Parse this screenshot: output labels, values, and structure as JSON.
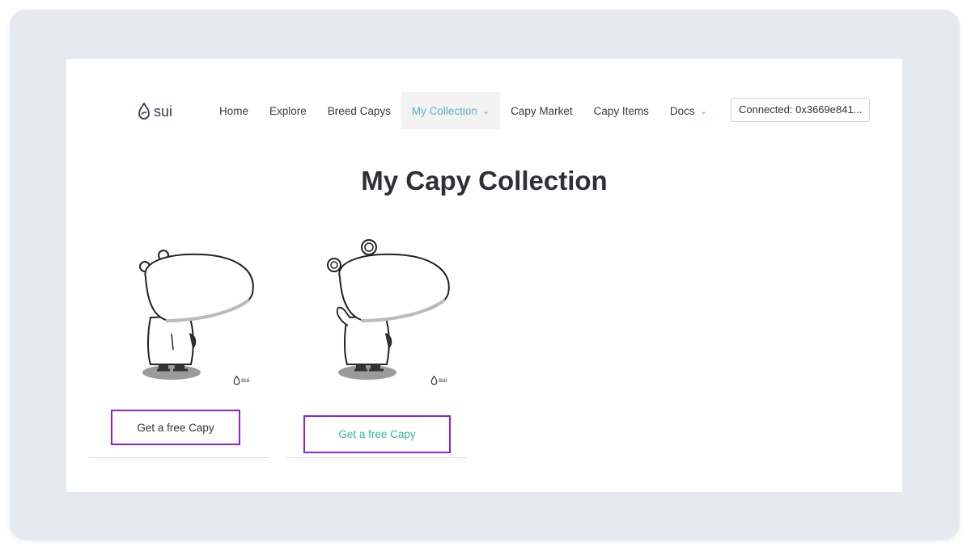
{
  "logo": {
    "text": "sui"
  },
  "nav": {
    "items": [
      {
        "label": "Home"
      },
      {
        "label": "Explore"
      },
      {
        "label": "Breed Capys"
      },
      {
        "label": "My Collection"
      },
      {
        "label": "Capy Market"
      },
      {
        "label": "Capy Items"
      },
      {
        "label": "Docs"
      }
    ],
    "wallet_label": "Connected: 0x3669e841..."
  },
  "main": {
    "title": "My Capy Collection",
    "cards": [
      {
        "button_label": "Get a free Capy",
        "watermark": "sui"
      },
      {
        "button_label": "Get a free Capy",
        "watermark": "sui"
      }
    ]
  },
  "colors": {
    "accent": "#5bb3cf",
    "highlight_border": "#8d1fe0",
    "button_text_active": "#2fb89a"
  }
}
